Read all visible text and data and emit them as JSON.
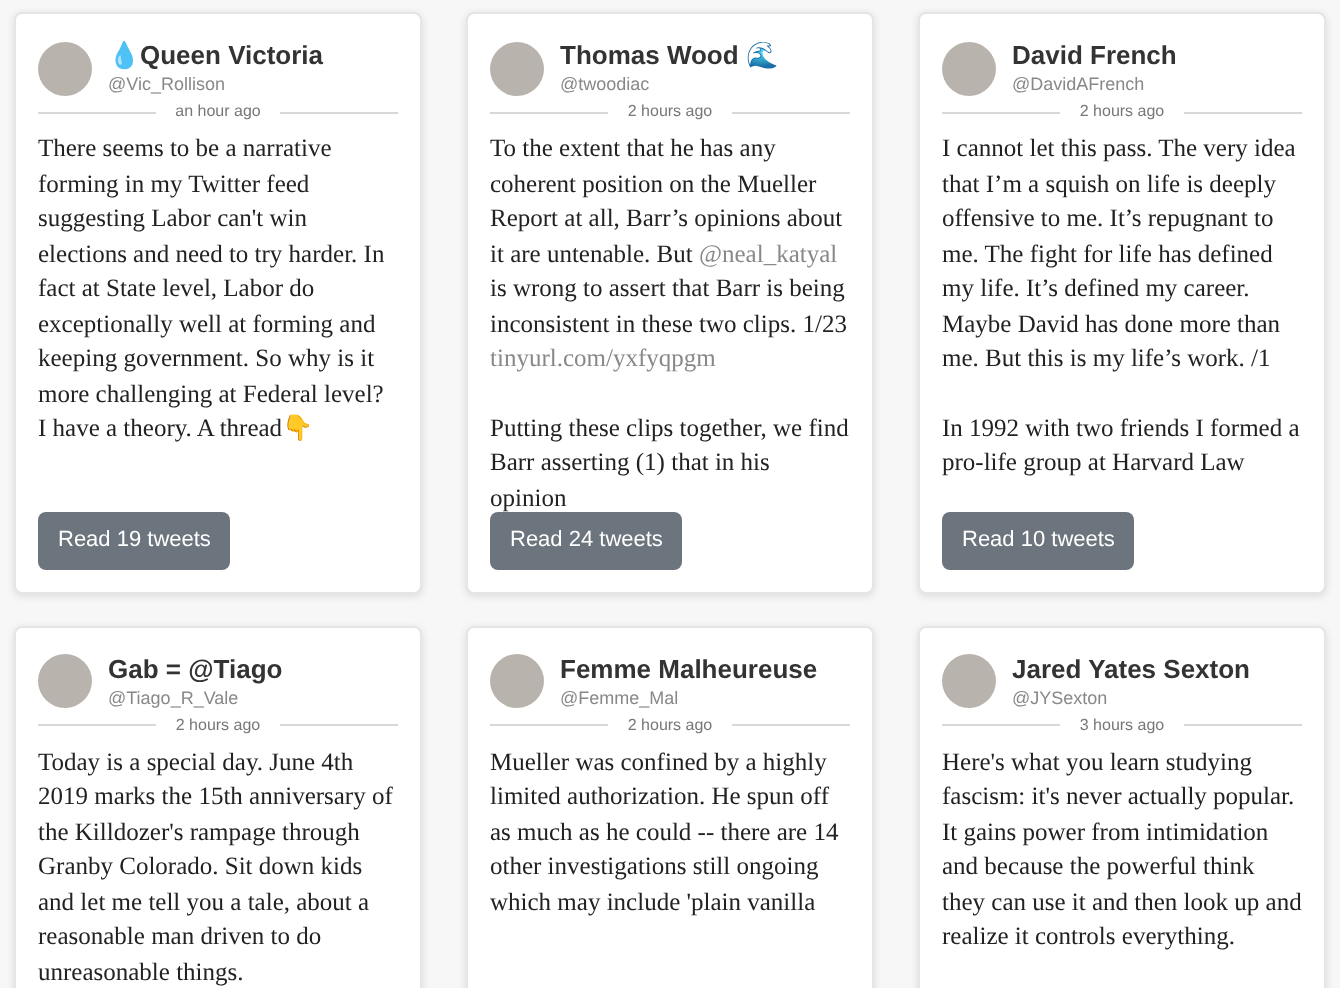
{
  "cards": [
    {
      "name": "💧Queen Victoria",
      "handle": "@Vic_Rollison",
      "time": "an hour ago",
      "paragraphs": [
        [
          {
            "kind": "text",
            "text": "There seems to be a narrative forming in my Twitter feed suggesting Labor can't win elections and need to try harder. In fact at State level, Labor do exceptionally well at forming and keeping government. So why is it more challenging at Federal level? I have a theory. A thread👇"
          }
        ]
      ],
      "button": "Read 19 tweets"
    },
    {
      "name": "Thomas Wood 🌊",
      "handle": "@twoodiac",
      "time": "2 hours ago",
      "paragraphs": [
        [
          {
            "kind": "text",
            "text": "To the extent that he has any coherent position on the Mueller Report at all, Barr’s opinions about it are untenable. But "
          },
          {
            "kind": "link",
            "text": "@neal_katyal"
          },
          {
            "kind": "text",
            "text": " is wrong to assert that Barr is being inconsistent in these two clips. 1/23 "
          },
          {
            "kind": "link",
            "text": "tinyurl.com/yxfyqpgm"
          }
        ],
        [
          {
            "kind": "text",
            "text": "Putting these clips together, we find Barr asserting (1) that in his opinion"
          }
        ]
      ],
      "button": "Read 24 tweets"
    },
    {
      "name": "David French",
      "handle": "@DavidAFrench",
      "time": "2 hours ago",
      "paragraphs": [
        [
          {
            "kind": "text",
            "text": "I cannot let this pass. The very idea that I’m a squish on life is deeply offensive to me. It’s repugnant to me. The fight for life has defined my life. It’s defined my career. Maybe David has done more than me. But this is my life’s work. /1"
          }
        ],
        [
          {
            "kind": "text",
            "text": "In 1992 with two friends I formed a pro-life group at Harvard Law"
          }
        ]
      ],
      "button": "Read 10 tweets"
    },
    {
      "name": "Gab = @Tiago",
      "handle": "@Tiago_R_Vale",
      "time": "2 hours ago",
      "paragraphs": [
        [
          {
            "kind": "text",
            "text": "Today is a special day. June 4th 2019 marks the 15th anniversary of the Killdozer's rampage through Granby Colorado. Sit down kids and let me tell you a tale, about a reasonable man driven to do unreasonable things."
          }
        ]
      ]
    },
    {
      "name": "Femme Malheureuse",
      "handle": "@Femme_Mal",
      "time": "2 hours ago",
      "paragraphs": [
        [
          {
            "kind": "text",
            "text": "Mueller was confined by a highly limited authorization. He spun off as much as he could -- there are 14 other investigations still ongoing which may include 'plain vanilla"
          }
        ]
      ]
    },
    {
      "name": "Jared Yates Sexton",
      "handle": "@JYSexton",
      "time": "3 hours ago",
      "paragraphs": [
        [
          {
            "kind": "text",
            "text": "Here's what you learn studying fascism: it's never actually popular. It gains power from intimidation and because the powerful think they can use it and then look up and realize it controls everything."
          }
        ]
      ]
    }
  ]
}
